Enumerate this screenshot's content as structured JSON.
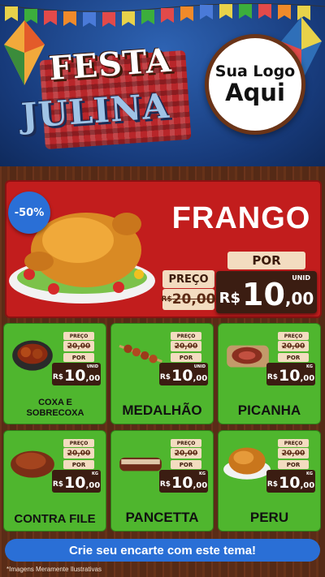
{
  "header": {
    "title_line1": "FESTA",
    "title_line2": "JULINA",
    "logo_line1": "Sua Logo",
    "logo_line2": "Aqui"
  },
  "featured": {
    "discount": "-50%",
    "name": "FRANGO",
    "preco_label": "PREÇO",
    "por_label": "POR",
    "old_price": "20,00",
    "old_currency": "R$",
    "currency": "R$",
    "price_int": "10",
    "price_dec": ",00",
    "unit": "UNID"
  },
  "products": [
    {
      "name": "COXA E SOBRECOXA",
      "old": "20,00",
      "currency": "R$",
      "int": "10",
      "dec": ",00",
      "unit": "UNID",
      "preco": "PREÇO",
      "por": "POR"
    },
    {
      "name": "MEDALHÃO",
      "old": "20,00",
      "currency": "R$",
      "int": "10",
      "dec": ",00",
      "unit": "UNID",
      "preco": "PREÇO",
      "por": "POR"
    },
    {
      "name": "PICANHA",
      "old": "20,00",
      "currency": "R$",
      "int": "10",
      "dec": ",00",
      "unit": "KG",
      "preco": "PREÇO",
      "por": "POR"
    },
    {
      "name": "CONTRA FILE",
      "old": "20,00",
      "currency": "R$",
      "int": "10",
      "dec": ",00",
      "unit": "KG",
      "preco": "PREÇO",
      "por": "POR"
    },
    {
      "name": "PANCETTA",
      "old": "20,00",
      "currency": "R$",
      "int": "10",
      "dec": ",00",
      "unit": "KG",
      "preco": "PREÇO",
      "por": "POR"
    },
    {
      "name": "PERU",
      "old": "20,00",
      "currency": "R$",
      "int": "10",
      "dec": ",00",
      "unit": "KG",
      "preco": "PREÇO",
      "por": "POR"
    }
  ],
  "cta": "Crie seu encarte com este tema!",
  "footnote": "*Imagens Meramente Ilustrativas",
  "colors": {
    "header_blue": "#1f4a94",
    "offer_red": "#c21d1d",
    "card_green": "#4fb62e",
    "price_brown": "#3b1d12",
    "cta_blue": "#2a6fd6"
  }
}
